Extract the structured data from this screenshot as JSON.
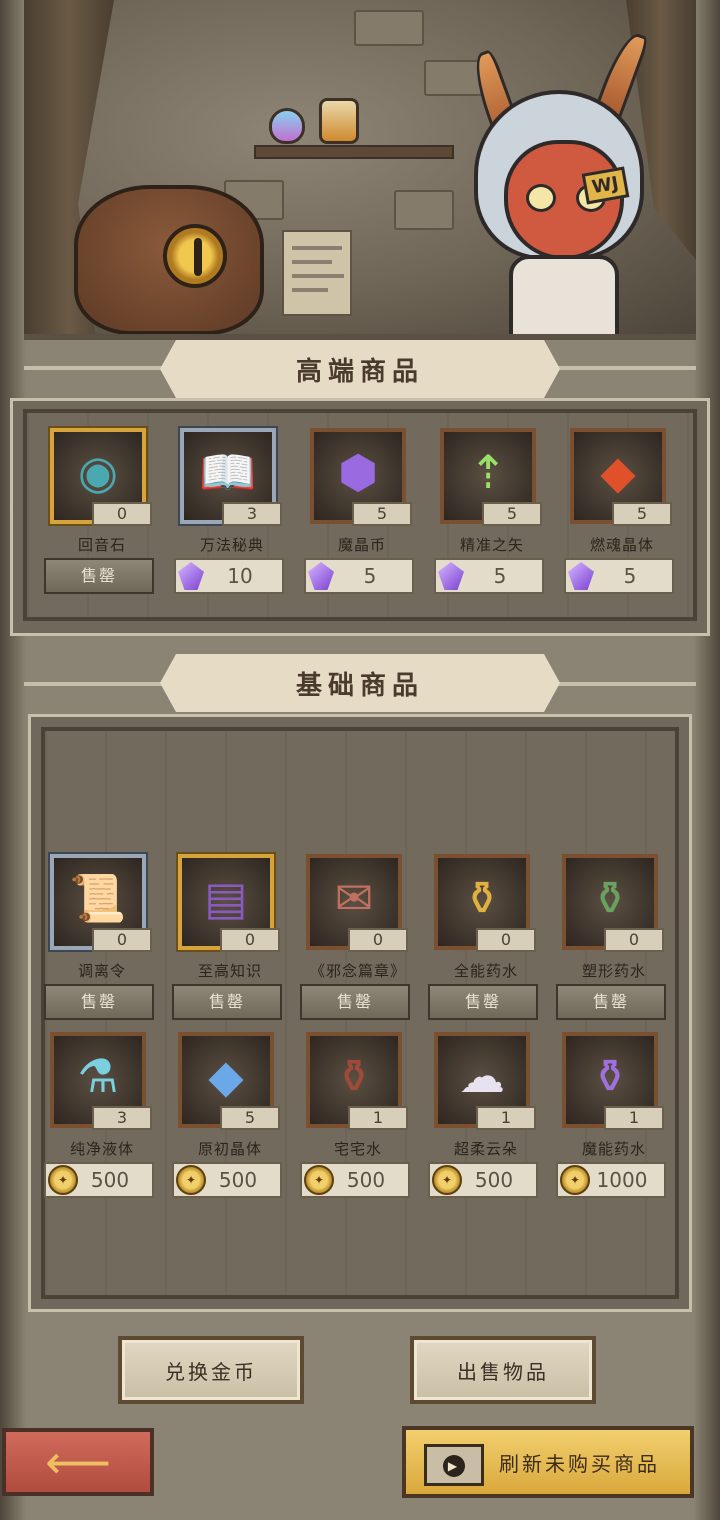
{
  "premium": {
    "title": "高端商品",
    "items": [
      {
        "name": "回音石",
        "count": "0",
        "action": "售罄",
        "icon": "echo-stone-icon",
        "frame": "gold",
        "glyph": "◉",
        "glyph_color": "#4aa8b0"
      },
      {
        "name": "万法秘典",
        "count": "3",
        "price": "10",
        "currency": "crystal-icon",
        "icon": "spell-tome-icon",
        "frame": "steel",
        "glyph": "📖",
        "glyph_color": "#e08a3a"
      },
      {
        "name": "魔晶币",
        "count": "5",
        "price": "5",
        "currency": "crystal-icon",
        "icon": "magic-crystal-coin-icon",
        "frame": "brown",
        "glyph": "⬢",
        "glyph_color": "#9a6ae0"
      },
      {
        "name": "精准之矢",
        "count": "5",
        "price": "5",
        "currency": "crystal-icon",
        "icon": "precision-arrow-icon",
        "frame": "brown",
        "glyph": "⇡",
        "glyph_color": "#9adf6a"
      },
      {
        "name": "燃魂晶体",
        "count": "5",
        "price": "5",
        "currency": "crystal-icon",
        "icon": "soul-burning-crystal-icon",
        "frame": "brown",
        "glyph": "◆",
        "glyph_color": "#e0502a"
      }
    ]
  },
  "basic": {
    "title": "基础商品",
    "row1": [
      {
        "name": "调离令",
        "count": "0",
        "action": "售罄",
        "icon": "transfer-order-scroll-icon",
        "frame": "steel",
        "glyph": "📜",
        "glyph_color": "#d8cfb0"
      },
      {
        "name": "至高知识",
        "count": "0",
        "action": "售罄",
        "icon": "supreme-knowledge-book-icon",
        "frame": "gold",
        "glyph": "▤",
        "glyph_color": "#8a5ac0"
      },
      {
        "name": "《邪念篇章》",
        "count": "0",
        "action": "售罄",
        "icon": "evil-chapter-icon",
        "frame": "brown",
        "glyph": "✉",
        "glyph_color": "#c07060"
      },
      {
        "name": "全能药水",
        "count": "0",
        "action": "售罄",
        "icon": "omni-potion-icon",
        "frame": "brown",
        "glyph": "⚱",
        "glyph_color": "#e0b040"
      },
      {
        "name": "塑形药水",
        "count": "0",
        "action": "售罄",
        "icon": "shaping-potion-icon",
        "frame": "brown",
        "glyph": "⚱",
        "glyph_color": "#6aa060"
      }
    ],
    "row2": [
      {
        "name": "纯净液体",
        "count": "3",
        "price": "500",
        "currency": "gold-coin-icon",
        "icon": "pure-liquid-icon",
        "frame": "brown",
        "glyph": "⚗",
        "glyph_color": "#7ad0e0"
      },
      {
        "name": "原初晶体",
        "count": "5",
        "price": "500",
        "currency": "gold-coin-icon",
        "icon": "primordial-crystal-icon",
        "frame": "brown",
        "glyph": "◆",
        "glyph_color": "#6aa8e8"
      },
      {
        "name": "宅宅水",
        "count": "1",
        "price": "500",
        "currency": "gold-coin-icon",
        "icon": "otaku-water-icon",
        "frame": "brown",
        "glyph": "⚱",
        "glyph_color": "#a04a3a"
      },
      {
        "name": "超柔云朵",
        "count": "1",
        "price": "500",
        "currency": "gold-coin-icon",
        "icon": "soft-cloud-icon",
        "frame": "brown",
        "glyph": "☁",
        "glyph_color": "#e8e2f0"
      },
      {
        "name": "魔能药水",
        "count": "1",
        "price": "1000",
        "currency": "gold-coin-icon",
        "icon": "magic-energy-potion-icon",
        "frame": "brown",
        "glyph": "⚱",
        "glyph_color": "#a070e0"
      }
    ]
  },
  "buttons": {
    "exchange_gold": "兑换金币",
    "sell_items": "出售物品",
    "refresh": "刷新未购买商品"
  },
  "npc_badge": "WJ",
  "colors": {
    "gold_frame": "#d6a33c",
    "steel_frame": "#9aa7b6",
    "brown_frame": "#7a5030",
    "back_button": "#c05a4b",
    "refresh_button": "#e8bd55"
  }
}
